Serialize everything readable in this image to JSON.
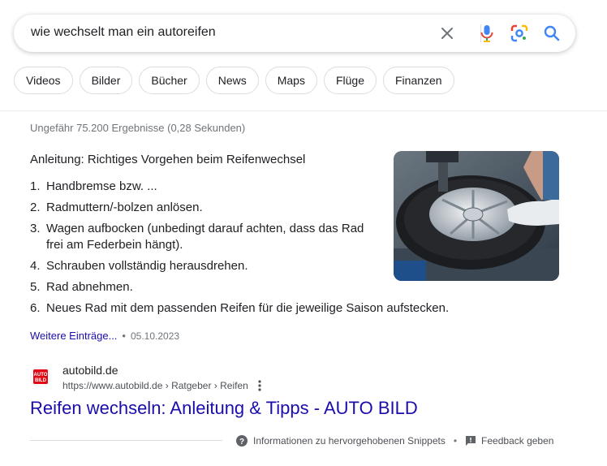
{
  "search": {
    "query": "wie wechselt man ein autoreifen"
  },
  "icons": {
    "clear": "close-icon",
    "voice": "microphone-icon",
    "lens": "camera-lens-icon",
    "search": "search-icon"
  },
  "chips": [
    "Videos",
    "Bilder",
    "Bücher",
    "News",
    "Maps",
    "Flüge",
    "Finanzen"
  ],
  "result_stats": "Ungefähr 75.200 Ergebnisse (0,28 Sekunden)",
  "snippet": {
    "heading": "Anleitung: Richtiges Vorgehen beim Reifenwechsel",
    "steps": [
      {
        "num": "1.",
        "text": "Handbremse bzw. ..."
      },
      {
        "num": "2.",
        "text": "Radmuttern/-bolzen anlösen."
      },
      {
        "num": "3.",
        "text": "Wagen aufbocken (unbedingt darauf achten, dass das Rad frei am Federbein hängt)."
      },
      {
        "num": "4.",
        "text": "Schrauben vollständig herausdrehen."
      },
      {
        "num": "5.",
        "text": "Rad abnehmen."
      },
      {
        "num": "6.",
        "text": "Neues Rad mit dem passenden Reifen für die jeweilige Saison aufstecken."
      }
    ],
    "more_link": "Weitere Einträge...",
    "date": "05.10.2023"
  },
  "result": {
    "favicon_text": "AUTO BILD",
    "site_name": "autobild.de",
    "url": "https://www.autobild.de › Ratgeber › Reifen",
    "title": "Reifen wechseln: Anleitung & Tipps - AUTO BILD"
  },
  "footer": {
    "info": "Informationen zu hervorgehobenen Snippets",
    "feedback": "Feedback geben"
  },
  "colors": {
    "link": "#1a0dab",
    "google_blue": "#4285f4",
    "google_red": "#ea4335",
    "google_yellow": "#fbbc04",
    "google_green": "#34a853"
  }
}
